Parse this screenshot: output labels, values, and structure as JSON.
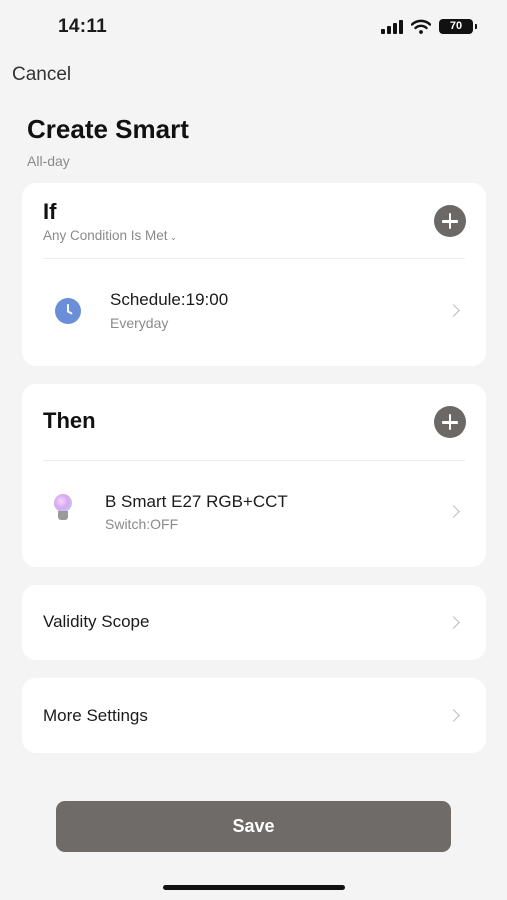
{
  "status_bar": {
    "time": "14:11",
    "battery": "70",
    "icons": [
      "signal-icon",
      "wifi-icon",
      "battery-icon"
    ]
  },
  "nav": {
    "cancel_label": "Cancel"
  },
  "header": {
    "title": "Create Smart",
    "subtitle": "All-day"
  },
  "if_section": {
    "title": "If",
    "condition_mode": "Any Condition Is Met",
    "conditions": [
      {
        "icon": "clock-icon",
        "title": "Schedule:19:00",
        "subtitle": "Everyday"
      }
    ]
  },
  "then_section": {
    "title": "Then",
    "actions": [
      {
        "icon": "bulb-icon",
        "title": "B Smart E27 RGB+CCT",
        "subtitle": "Switch:OFF"
      }
    ]
  },
  "validity": {
    "label": "Validity Scope"
  },
  "more_settings": {
    "label": "More Settings"
  },
  "footer": {
    "save_label": "Save"
  },
  "colors": {
    "background": "#f4f4f4",
    "card": "#ffffff",
    "button": "#6e6b68",
    "clock_accent": "#6a8fd8"
  }
}
